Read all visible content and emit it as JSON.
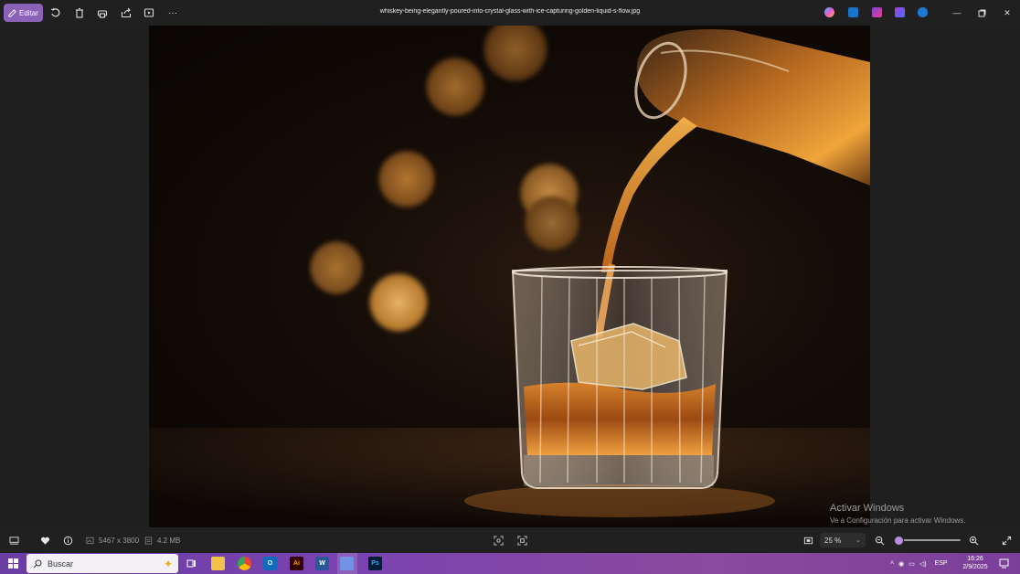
{
  "toolbar": {
    "edit_label": "Editar",
    "filename": "whiskey-being-elegantly-poured-into-crystal-glass-with-ice-capturing-golden-liquid-s-flow.jpg",
    "tools": [
      "rotate-icon",
      "delete-icon",
      "print-icon",
      "share-icon",
      "slideshow-icon",
      "more-icon"
    ],
    "apps": [
      "copilot-icon",
      "edit-app-icon",
      "clipchamp-icon",
      "designer-icon",
      "onedrive-icon"
    ]
  },
  "watermark": {
    "line1": "Activar Windows",
    "line2": "Ve a Configuración para activar Windows."
  },
  "status": {
    "dimensions": "5467 x 3800",
    "file_size": "4.2 MB",
    "zoom_level": "25 %",
    "zoom_fraction": 0.25
  },
  "taskbar": {
    "search_placeholder": "Buscar",
    "apps": [
      "task-view-icon",
      "file-explorer-icon",
      "chrome-icon",
      "outlook-icon",
      "illustrator-icon",
      "word-icon",
      "photos-icon",
      "photoshop-icon"
    ],
    "language": "ESP",
    "time": "16:26",
    "date": "2/9/2025"
  },
  "colors": {
    "accent": "#8b62b8",
    "taskbar": "#7b43b0",
    "background": "#1f1f1f"
  }
}
